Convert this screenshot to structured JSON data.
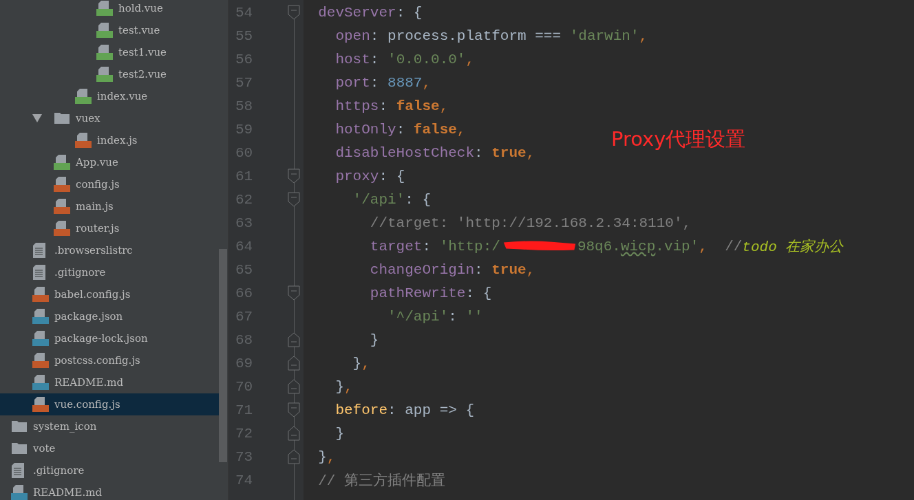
{
  "project_tree": [
    {
      "children": [
        {
          "children": [
            {
              "children": [
                {
                  "children": [
                    {
                      "name": "hold.vue",
                      "kind": "vue",
                      "selected": false
                    },
                    {
                      "name": "test.vue",
                      "kind": "vue",
                      "selected": false
                    },
                    {
                      "name": "test1.vue",
                      "kind": "vue",
                      "selected": false
                    },
                    {
                      "name": "test2.vue",
                      "kind": "vue",
                      "selected": false
                    }
                  ]
                },
                {
                  "name": "index.vue",
                  "kind": "vue",
                  "selected": false
                }
              ]
            },
            {
              "name": "vuex",
              "kind": "folder",
              "expanded": true,
              "selected": false,
              "children": [
                {
                  "name": "index.js",
                  "kind": "js",
                  "selected": false
                }
              ]
            },
            {
              "name": "App.vue",
              "kind": "vue",
              "selected": false
            },
            {
              "name": "config.js",
              "kind": "js",
              "selected": false
            },
            {
              "name": "main.js",
              "kind": "js",
              "selected": false
            },
            {
              "name": "router.js",
              "kind": "js",
              "selected": false
            }
          ]
        },
        {
          "name": ".browserslistrc",
          "kind": "text",
          "selected": false
        },
        {
          "name": ".gitignore",
          "kind": "text",
          "selected": false
        },
        {
          "name": "babel.config.js",
          "kind": "js",
          "selected": false
        },
        {
          "name": "package.json",
          "kind": "json",
          "selected": false
        },
        {
          "name": "package-lock.json",
          "kind": "json",
          "selected": false
        },
        {
          "name": "postcss.config.js",
          "kind": "js",
          "selected": false
        },
        {
          "name": "README.md",
          "kind": "md",
          "selected": false
        },
        {
          "name": "vue.config.js",
          "kind": "js",
          "selected": true
        }
      ]
    },
    {
      "name": "system_icon",
      "kind": "folder",
      "selected": false
    },
    {
      "name": "vote",
      "kind": "folder",
      "selected": false
    },
    {
      "name": ".gitignore",
      "kind": "text",
      "selected": false
    },
    {
      "name": "README.md",
      "kind": "md",
      "selected": false
    }
  ],
  "editor": {
    "lines": [
      {
        "number": "54",
        "kind": "fold-start",
        "tokens": [
          {
            "kind": "property",
            "text": "  devServer"
          },
          {
            "kind": "plain",
            "text": ": {"
          }
        ]
      },
      {
        "number": "55",
        "kind": "plain",
        "tokens": [
          {
            "kind": "property",
            "text": "    open"
          },
          {
            "kind": "plain",
            "text": ": process.platform === "
          },
          {
            "kind": "string",
            "text": "'darwin'"
          },
          {
            "kind": "punct",
            "text": ","
          }
        ]
      },
      {
        "number": "56",
        "kind": "plain",
        "tokens": [
          {
            "kind": "property",
            "text": "    host"
          },
          {
            "kind": "plain",
            "text": ": "
          },
          {
            "kind": "string",
            "text": "'0.0.0.0'"
          },
          {
            "kind": "punct",
            "text": ","
          }
        ]
      },
      {
        "number": "57",
        "kind": "plain",
        "tokens": [
          {
            "kind": "property",
            "text": "    port"
          },
          {
            "kind": "plain",
            "text": ": "
          },
          {
            "kind": "number",
            "text": "8887"
          },
          {
            "kind": "punct",
            "text": ","
          }
        ]
      },
      {
        "number": "58",
        "kind": "plain",
        "tokens": [
          {
            "kind": "property",
            "text": "    https"
          },
          {
            "kind": "plain",
            "text": ": "
          },
          {
            "kind": "keyword",
            "text": "false"
          },
          {
            "kind": "punct",
            "text": ","
          }
        ]
      },
      {
        "number": "59",
        "kind": "plain",
        "tokens": [
          {
            "kind": "property",
            "text": "    hotOnly"
          },
          {
            "kind": "plain",
            "text": ": "
          },
          {
            "kind": "keyword",
            "text": "false"
          },
          {
            "kind": "punct",
            "text": ","
          }
        ]
      },
      {
        "number": "60",
        "kind": "plain",
        "tokens": [
          {
            "kind": "property",
            "text": "    disableHostCheck"
          },
          {
            "kind": "plain",
            "text": ": "
          },
          {
            "kind": "keyword",
            "text": "true"
          },
          {
            "kind": "punct",
            "text": ","
          }
        ]
      },
      {
        "number": "61",
        "kind": "fold-start",
        "tokens": [
          {
            "kind": "property",
            "text": "    proxy"
          },
          {
            "kind": "plain",
            "text": ": {"
          }
        ]
      },
      {
        "number": "62",
        "kind": "fold-start",
        "tokens": [
          {
            "kind": "string",
            "text": "      '/api'"
          },
          {
            "kind": "plain",
            "text": ": {"
          }
        ]
      },
      {
        "number": "63",
        "kind": "plain",
        "tokens": [
          {
            "kind": "comment",
            "text": "        //target: 'http://192.168.2.34:8110',"
          }
        ]
      },
      {
        "number": "64",
        "kind": "plain",
        "tokens": [
          {
            "kind": "property",
            "text": "        target"
          },
          {
            "kind": "plain",
            "text": ": "
          },
          {
            "kind": "string",
            "text": "'http:/"
          },
          {
            "kind": "redaction"
          },
          {
            "kind": "string",
            "text": "98q6."
          },
          {
            "kind": "typo",
            "text": "wicp"
          },
          {
            "kind": "string",
            "text": ".vip'"
          },
          {
            "kind": "punct",
            "text": ",  "
          },
          {
            "kind": "comment",
            "text": "//"
          },
          {
            "kind": "todo",
            "text": "todo 在家办公"
          }
        ]
      },
      {
        "number": "65",
        "kind": "plain",
        "tokens": [
          {
            "kind": "property",
            "text": "        changeOrigin"
          },
          {
            "kind": "plain",
            "text": ": "
          },
          {
            "kind": "keyword",
            "text": "true"
          },
          {
            "kind": "punct",
            "text": ","
          }
        ]
      },
      {
        "number": "66",
        "kind": "fold-start",
        "tokens": [
          {
            "kind": "property",
            "text": "        pathRewrite"
          },
          {
            "kind": "plain",
            "text": ": {"
          }
        ]
      },
      {
        "number": "67",
        "kind": "plain",
        "tokens": [
          {
            "kind": "string",
            "text": "          '^/api'"
          },
          {
            "kind": "plain",
            "text": ": "
          },
          {
            "kind": "string",
            "text": "''"
          }
        ]
      },
      {
        "number": "68",
        "kind": "fold-end",
        "tokens": [
          {
            "kind": "plain",
            "text": "        }"
          }
        ]
      },
      {
        "number": "69",
        "kind": "fold-end",
        "tokens": [
          {
            "kind": "plain",
            "text": "      }"
          },
          {
            "kind": "punct",
            "text": ","
          }
        ]
      },
      {
        "number": "70",
        "kind": "fold-end",
        "tokens": [
          {
            "kind": "plain",
            "text": "    }"
          },
          {
            "kind": "punct",
            "text": ","
          }
        ]
      },
      {
        "number": "71",
        "kind": "fold-start",
        "tokens": [
          {
            "kind": "function",
            "text": "    before"
          },
          {
            "kind": "plain",
            "text": ": app => {"
          }
        ]
      },
      {
        "number": "72",
        "kind": "fold-end",
        "tokens": [
          {
            "kind": "plain",
            "text": "    }"
          }
        ]
      },
      {
        "number": "73",
        "kind": "fold-end",
        "tokens": [
          {
            "kind": "plain",
            "text": "  }"
          },
          {
            "kind": "punct",
            "text": ","
          }
        ]
      },
      {
        "number": "74",
        "kind": "plain",
        "tokens": [
          {
            "kind": "comment",
            "text": "  // 第三方插件配置"
          }
        ]
      }
    ],
    "annotation": "Proxy代理设置"
  }
}
